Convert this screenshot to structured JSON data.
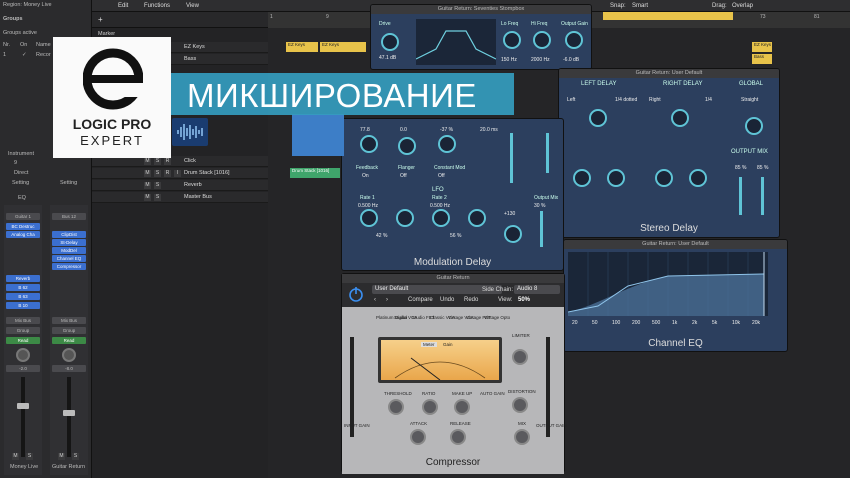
{
  "inspector": {
    "region": "Region: Money Live",
    "groups_header": "Groups",
    "groups_active": "Groups active",
    "group_cols": [
      "Nr.",
      "On",
      "Name"
    ],
    "group_row": [
      "1",
      "✓",
      "Recor"
    ],
    "strip1": {
      "instrument": "Instrument",
      "val": "9",
      "direct": "Direct",
      "setting": "Setting",
      "eq": "EQ",
      "name_slot": "Guitar 1",
      "plugins": [
        "BC Destruc",
        "Analog Cha"
      ],
      "sends": [
        "Reverb",
        "B 62",
        "B 63",
        "B 10"
      ],
      "output": "Mix Bus",
      "group": "Group",
      "auto": "Read",
      "vol": "-2.0",
      "bottom_name": "Money Live"
    },
    "strip2": {
      "setting": "Setting",
      "name_slot": "Bus 12",
      "plugins": [
        "ClipDist",
        "St-Delay",
        "ModDel",
        "Channel EQ",
        "Compressor"
      ],
      "output": "Mix Bus",
      "group": "Group",
      "auto": "Read",
      "vol": "-8.0",
      "bottom_name": "Guitar Return"
    }
  },
  "topbar": {
    "edit": "Edit",
    "functions": "Functions",
    "view": "View",
    "snap_label": "Snap:",
    "snap": "Smart",
    "drag_label": "Drag:",
    "drag": "Overlap"
  },
  "ruler": [
    "1",
    "9",
    "17",
    "25",
    "33",
    "41",
    "49",
    "57",
    "65",
    "73",
    "81"
  ],
  "tracks": {
    "marker": "Marker",
    "rows": [
      {
        "name": "EZ Keys"
      },
      {
        "name": "Bass"
      },
      {
        "name": "Click"
      },
      {
        "name": "Drum Stack [1016]"
      },
      {
        "name": "Reverb"
      },
      {
        "name": "Master Bus"
      }
    ],
    "ms": [
      "M",
      "S",
      "R",
      "I"
    ]
  },
  "regions": {
    "ezkeys": "EZ Keys",
    "bass": "Bass",
    "drumstack": "Drum Stack [1016]"
  },
  "logo": {
    "line1": "LOGIC PRO",
    "line2": "EXPERT"
  },
  "banner": {
    "text": "МИКШИРОВАНИЕ"
  },
  "plugins": {
    "stomp": {
      "title": "Guitar Return: Seventies Stompbox",
      "labels": [
        "Drive",
        "Bite Mode",
        "Lo Freq",
        "Hi Freq",
        "Output Gain"
      ],
      "values": [
        "47.1 dB",
        "150 Hz",
        "2000 Hz",
        "0.0 dB",
        "-6.0 dB"
      ]
    },
    "moddelay": {
      "title": "Guitar Return: ModDel",
      "name": "Modulation Delay",
      "lfo": "LFO",
      "values": [
        "77.8",
        "0.0",
        "-37 %",
        "20.0 ms",
        "0.500 Hz",
        "0.500 Hz",
        "42 %",
        "56 %",
        "+130",
        "30 %"
      ],
      "labels": [
        "Feedback",
        "Flanger",
        "Constant Mod",
        "Distortion",
        "Rate 1",
        "Rate 2",
        "Mix",
        "Output Mix"
      ],
      "btns": [
        "On",
        "Off",
        "Off"
      ]
    },
    "stereo": {
      "title": "Guitar Return: User Default",
      "name": "Stereo Delay",
      "left": "LEFT DELAY",
      "right": "RIGHT DELAY",
      "global": "GLOBAL",
      "outmix": "OUTPUT MIX",
      "labels": [
        "Source",
        "Note",
        "Feedback",
        "Crossfeed",
        "Stereo Phase",
        "Beat Sync"
      ],
      "vals": [
        "Left",
        "1/4 dotted",
        "Right",
        "1/4",
        "Straight",
        "85 %",
        "85 %"
      ]
    },
    "eq": {
      "title": "Guitar Return: User Default",
      "name": "Channel EQ",
      "freqs": [
        "20",
        "50",
        "100",
        "200",
        "500",
        "1k",
        "2k",
        "5k",
        "10k",
        "20k"
      ]
    },
    "comp": {
      "title": "Guitar Return",
      "preset": "User Default",
      "side_chain_label": "Side Chain:",
      "side_chain": "Audio 8",
      "compare": "Compare",
      "undo": "Undo",
      "redo": "Redo",
      "view_label": "View:",
      "view": "50%",
      "modes": [
        "Platinum Digital",
        "Studio VCA",
        "Studio FET",
        "Classic VCA",
        "Vintage VCA",
        "Vintage FET",
        "Vintage Opto"
      ],
      "meter_tabs": [
        "Meter",
        "Gain"
      ],
      "knobs": [
        "THRESHOLD",
        "RATIO",
        "MAKE UP",
        "AUTO GAIN",
        "ATTACK",
        "RELEASE",
        "MIX",
        "INPUT GAIN",
        "OUTPUT GAIN",
        "LIMITER",
        "DISTORTION"
      ],
      "name": "Compressor"
    }
  },
  "colors": {
    "banner": "#349cbe",
    "plugin_blue": "#2c3f5e",
    "accent": "#5fc4d6",
    "region_yellow": "#e8c34a",
    "region_green": "#3fa56b"
  }
}
